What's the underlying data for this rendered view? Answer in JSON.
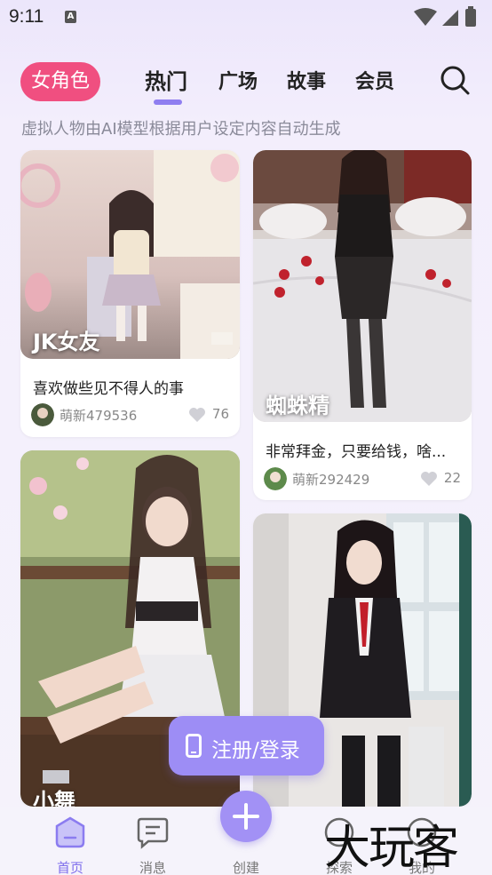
{
  "status_bar": {
    "time": "9:11",
    "notification_letter": "A",
    "icons": [
      "wifi-icon",
      "signal-icon",
      "battery-icon"
    ]
  },
  "top_nav": {
    "category_pill": "女角色",
    "tabs": [
      {
        "label": "热门",
        "active": true
      },
      {
        "label": "广场",
        "active": false
      },
      {
        "label": "故事",
        "active": false
      },
      {
        "label": "会员",
        "active": false
      }
    ],
    "search_icon": "search-icon"
  },
  "subtitle": "虚拟人物由AI模型根据用户设定内容自动生成",
  "cards": [
    {
      "name": "JK女友",
      "desc": "喜欢做些见不得人的事",
      "author": "萌新479536",
      "likes": "76"
    },
    {
      "name": "蜘蛛精",
      "desc": "非常拜金，只要给钱，啥...",
      "author": "萌新292429",
      "likes": "22"
    },
    {
      "name": "小舞"
    },
    {
      "name": ""
    }
  ],
  "login_button": {
    "label": "注册/登录",
    "icon": "phone-icon"
  },
  "bottom_nav": {
    "items": [
      {
        "label": "首页",
        "icon": "home-icon",
        "active": true
      },
      {
        "label": "消息",
        "icon": "message-icon",
        "active": false
      },
      {
        "label": "创建",
        "icon": "plus-icon",
        "active": false
      },
      {
        "label": "探索",
        "icon": "explore-icon",
        "active": false
      },
      {
        "label": "我的",
        "icon": "profile-icon",
        "active": false
      }
    ]
  },
  "watermark": "大玩客",
  "colors": {
    "accent": "#9d8df5",
    "pill": "#f04f80",
    "indicator": "#8f7ef0"
  }
}
